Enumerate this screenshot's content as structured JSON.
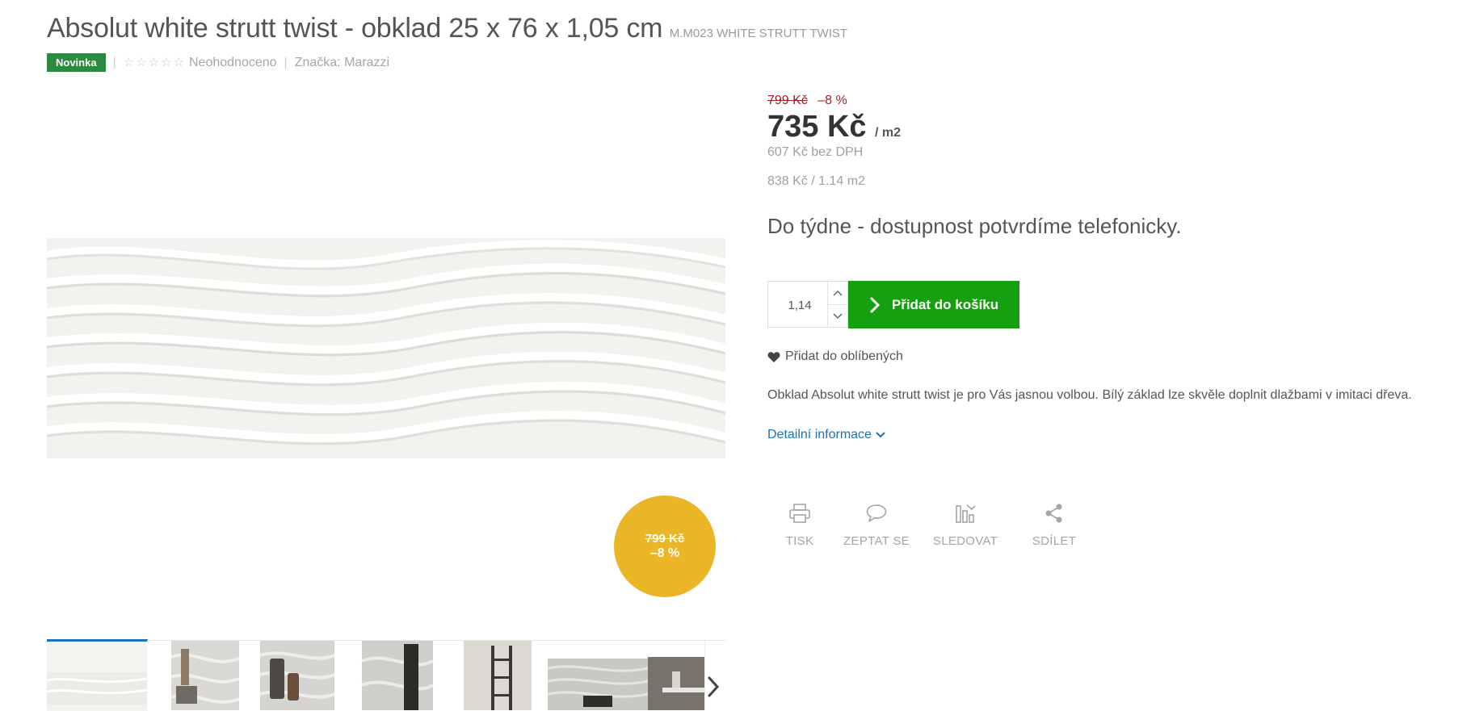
{
  "product": {
    "title": "Absolut white strutt twist - obklad 25 x 76 x 1,05 cm",
    "code": "M.M023 WHITE STRUTT TWIST",
    "badge": "Novinka",
    "rating_text": "Neohodnoceno",
    "rating_stars_max": 5,
    "brand": "Značka: Marazzi"
  },
  "price": {
    "old": "799 Kč",
    "discount": "–8 %",
    "current": "735 Kč",
    "unit": "/ m2",
    "without_vat": "607 Kč bez DPH",
    "package_price": "838 Kč / 1.14 m2"
  },
  "discount_disc": {
    "old": "799 Kč",
    "discount": "–8 %",
    "color": "#ebb528"
  },
  "availability": "Do týdne - dostupnost potvrdíme telefonicky.",
  "cart": {
    "quantity": "1,14",
    "add_label": "Přidat do košíku",
    "button_color": "#15a00f"
  },
  "favorite_label": "Přidat do oblíbených",
  "description": "Obklad Absolut white strutt twist je pro Vás jasnou volbou. Bílý základ lze skvěle doplnit dlažbami v imitaci dřeva.",
  "detail_link": "Detailní informace",
  "tools": [
    {
      "label": "TISK",
      "icon": "printer-icon"
    },
    {
      "label": "ZEPTAT SE",
      "icon": "speech-bubble-icon"
    },
    {
      "label": "SLEDOVAT",
      "icon": "watch-chart-icon"
    },
    {
      "label": "SDÍLET",
      "icon": "share-icon"
    }
  ],
  "gallery": {
    "thumbnail_count": 7,
    "active_index": 0
  },
  "colors": {
    "badge": "#2b8a3e",
    "old_price": "#9b2227",
    "link": "#1a73b3"
  }
}
